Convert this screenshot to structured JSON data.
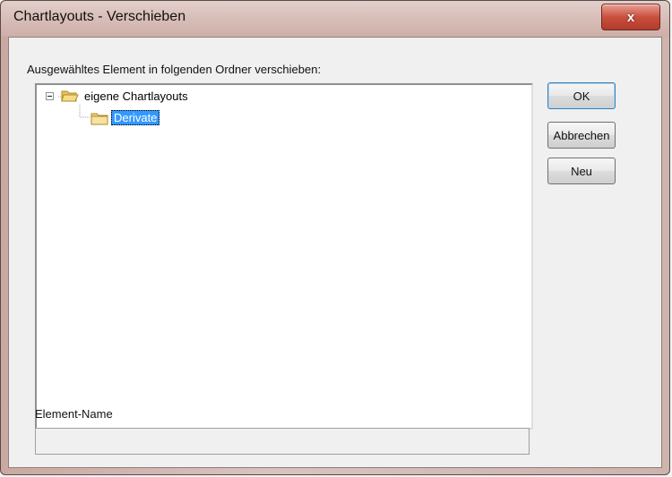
{
  "window": {
    "title": "Chartlayouts - Verschieben",
    "close_label": "x"
  },
  "dialog": {
    "instruction": "Ausgewähltes Element in folgenden Ordner verschieben:",
    "tree": {
      "root": {
        "label": "eigene Chartlayouts",
        "expanded": true
      },
      "children": [
        {
          "label": "Derivate",
          "selected": true
        }
      ]
    },
    "element_name_label": "Element-Name",
    "element_name_value": ""
  },
  "buttons": {
    "ok": "OK",
    "cancel": "Abbrechen",
    "new": "Neu"
  },
  "colors": {
    "selection": "#3399ff",
    "close_button": "#c9503f"
  }
}
